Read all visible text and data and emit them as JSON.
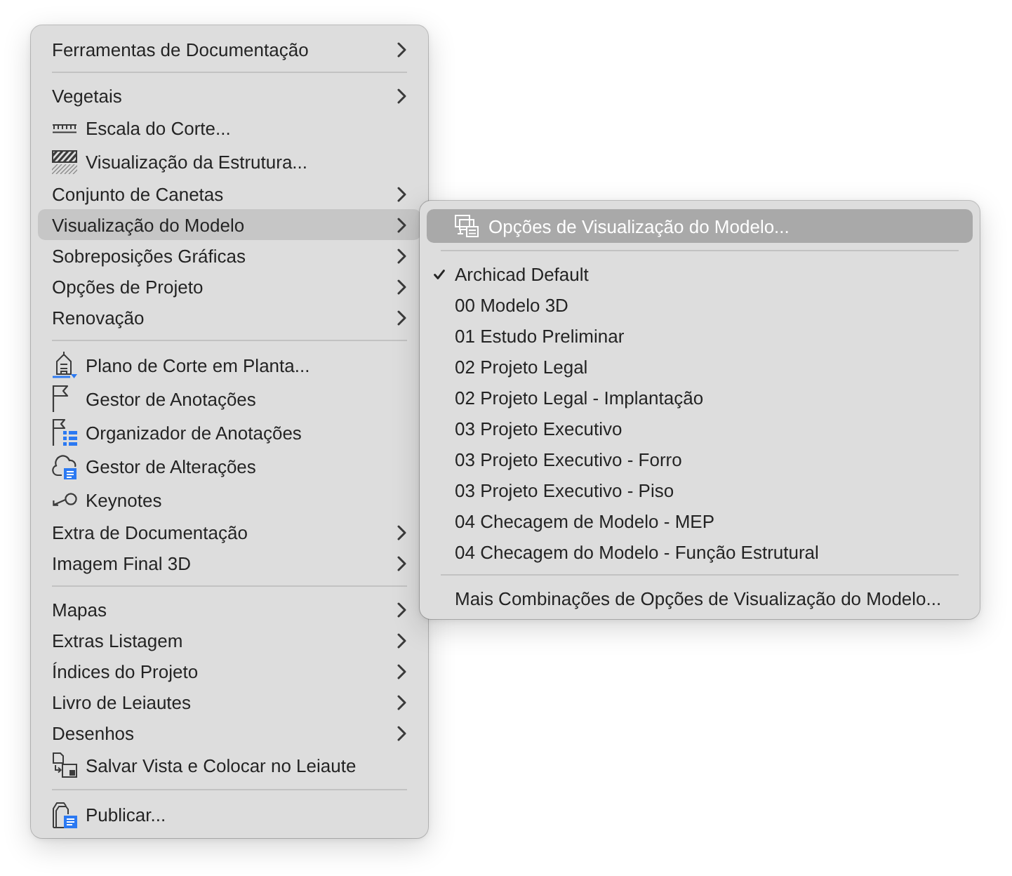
{
  "menu": {
    "focused": false,
    "sections": [
      {
        "items": [
          {
            "label": "Ferramentas de Documentação",
            "kind": "submenu",
            "selected": false
          }
        ]
      },
      {
        "items": [
          {
            "label": "Vegetais",
            "kind": "submenu",
            "selected": false
          },
          {
            "label": "Escala do Corte...",
            "kind": "command",
            "selected": false
          },
          {
            "label": "Visualização da Estrutura...",
            "kind": "command",
            "selected": false
          },
          {
            "label": "Conjunto de Canetas",
            "kind": "submenu",
            "selected": false
          },
          {
            "label": "Visualização do Modelo",
            "kind": "submenu",
            "selected": true
          },
          {
            "label": "Sobreposições Gráficas",
            "kind": "submenu",
            "selected": false
          },
          {
            "label": "Opções de Projeto",
            "kind": "submenu",
            "selected": false
          },
          {
            "label": "Renovação",
            "kind": "submenu",
            "selected": false
          }
        ]
      },
      {
        "items": [
          {
            "label": "Plano de Corte em Planta...",
            "kind": "command",
            "selected": false
          },
          {
            "label": "Gestor de Anotações",
            "kind": "command",
            "selected": false
          },
          {
            "label": "Organizador de Anotações",
            "kind": "command",
            "selected": false
          },
          {
            "label": "Gestor de Alterações",
            "kind": "command",
            "selected": false
          },
          {
            "label": "Keynotes",
            "kind": "command",
            "selected": false
          },
          {
            "label": "Extra de Documentação",
            "kind": "submenu",
            "selected": false
          },
          {
            "label": "Imagem Final 3D",
            "kind": "submenu",
            "selected": false
          }
        ]
      },
      {
        "items": [
          {
            "label": "Mapas",
            "kind": "submenu",
            "selected": false
          },
          {
            "label": "Extras Listagem",
            "kind": "submenu",
            "selected": false
          },
          {
            "label": "Índices do Projeto",
            "kind": "submenu",
            "selected": false
          },
          {
            "label": "Livro de Leiautes",
            "kind": "submenu",
            "selected": false
          },
          {
            "label": "Desenhos",
            "kind": "submenu",
            "selected": false
          },
          {
            "label": "Salvar Vista e Colocar no Leiaute",
            "kind": "command",
            "selected": false
          }
        ]
      },
      {
        "items": [
          {
            "label": "Publicar...",
            "kind": "command",
            "selected": false
          }
        ]
      }
    ]
  },
  "submenu": {
    "focused": true,
    "sections": [
      {
        "items": [
          {
            "label": "Opções de Visualização do Modelo...",
            "kind": "command",
            "selected": true
          }
        ]
      },
      {
        "items": [
          {
            "label": "Archicad Default",
            "kind": "option",
            "checked": true,
            "selected": false
          },
          {
            "label": "00 Modelo 3D",
            "kind": "option",
            "checked": false,
            "selected": false
          },
          {
            "label": "01 Estudo Preliminar",
            "kind": "option",
            "checked": false,
            "selected": false
          },
          {
            "label": "02 Projeto Legal",
            "kind": "option",
            "checked": false,
            "selected": false
          },
          {
            "label": "02 Projeto Legal - Implantação",
            "kind": "option",
            "checked": false,
            "selected": false
          },
          {
            "label": "03 Projeto Executivo",
            "kind": "option",
            "checked": false,
            "selected": false
          },
          {
            "label": "03 Projeto Executivo - Forro",
            "kind": "option",
            "checked": false,
            "selected": false
          },
          {
            "label": "03 Projeto Executivo - Piso",
            "kind": "option",
            "checked": false,
            "selected": false
          },
          {
            "label": "04 Checagem de Modelo - MEP",
            "kind": "option",
            "checked": false,
            "selected": false
          },
          {
            "label": "04 Checagem do Modelo - Função Estrutural",
            "kind": "option",
            "checked": false,
            "selected": false
          }
        ]
      },
      {
        "items": [
          {
            "label": "Mais Combinações de Opções de Visualização do Modelo...",
            "kind": "plain",
            "selected": false
          }
        ]
      }
    ]
  }
}
